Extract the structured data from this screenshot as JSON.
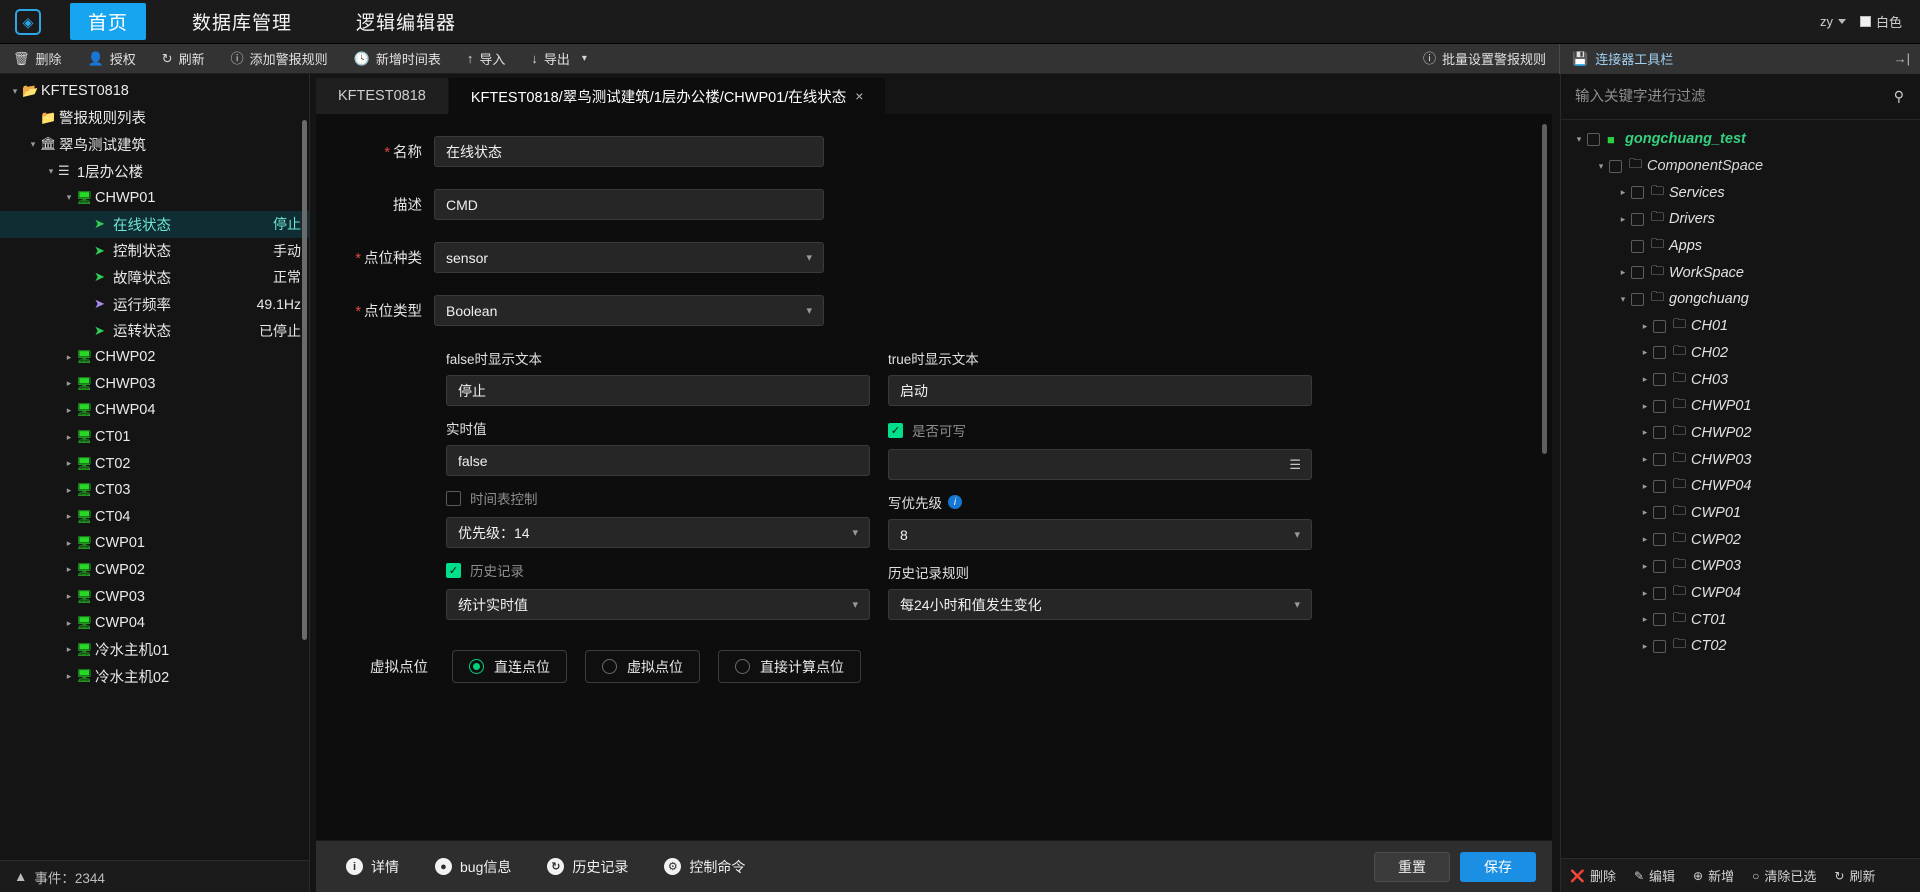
{
  "topbar": {
    "logo_icon": "cube-icon",
    "nav": [
      {
        "label": "首页",
        "active": true
      },
      {
        "label": "数据库管理",
        "active": false
      },
      {
        "label": "逻辑编辑器",
        "active": false
      }
    ],
    "user": "zy",
    "theme_label": "白色"
  },
  "toolbar": {
    "items": [
      {
        "label": "删除",
        "icon": "trash-icon"
      },
      {
        "label": "授权",
        "icon": "user-icon"
      },
      {
        "label": "刷新",
        "icon": "refresh-icon"
      },
      {
        "label": "添加警报规则",
        "icon": "alert-icon"
      },
      {
        "label": "新增时间表",
        "icon": "clock-icon"
      },
      {
        "label": "导入",
        "icon": "import-arrow-up-icon"
      },
      {
        "label": "导出",
        "icon": "export-arrow-down-icon"
      }
    ],
    "export_caret": "chevron-down-icon",
    "batch_alarm": {
      "label": "批量设置警报规则",
      "icon": "alert-icon"
    },
    "connector_panel": {
      "label": "连接器工具栏",
      "icon": "save-disk-icon",
      "expand_icon": "expand-right-icon"
    }
  },
  "tree": {
    "scrollbar": "vertical-scrollbar",
    "nodes": [
      {
        "label": "KFTEST0818",
        "value": "",
        "depth": 0,
        "twisty": "down",
        "icon": "folder-open-icon",
        "icon_class": "ico-folder",
        "selected": false
      },
      {
        "label": "警报规则列表",
        "value": "",
        "depth": 1,
        "twisty": "none",
        "icon": "folder-icon",
        "icon_class": "ico-folder",
        "selected": false
      },
      {
        "label": "翠鸟测试建筑",
        "value": "",
        "depth": 1,
        "twisty": "down",
        "icon": "building-icon",
        "icon_class": "ico-building",
        "selected": false
      },
      {
        "label": "1层办公楼",
        "value": "",
        "depth": 2,
        "twisty": "down",
        "icon": "layers-icon",
        "icon_class": "ico-layer",
        "selected": false
      },
      {
        "label": "CHWP01",
        "value": "",
        "depth": 3,
        "twisty": "down",
        "icon": "device-icon",
        "icon_class": "ico-dev",
        "selected": false
      },
      {
        "label": "在线状态",
        "value": "停止",
        "depth": 4,
        "twisty": "none",
        "icon": "point-icon",
        "icon_class": "ico-pt-green",
        "selected": true
      },
      {
        "label": "控制状态",
        "value": "手动",
        "depth": 4,
        "twisty": "none",
        "icon": "point-icon",
        "icon_class": "ico-pt-green",
        "selected": false
      },
      {
        "label": "故障状态",
        "value": "正常",
        "depth": 4,
        "twisty": "none",
        "icon": "point-icon",
        "icon_class": "ico-pt-green",
        "selected": false
      },
      {
        "label": "运行频率",
        "value": "49.1Hz",
        "depth": 4,
        "twisty": "none",
        "icon": "point-icon",
        "icon_class": "ico-pt-purple",
        "selected": false
      },
      {
        "label": "运转状态",
        "value": "已停止",
        "depth": 4,
        "twisty": "none",
        "icon": "point-icon",
        "icon_class": "ico-pt-green",
        "selected": false
      },
      {
        "label": "CHWP02",
        "value": "",
        "depth": 3,
        "twisty": "right",
        "icon": "device-icon",
        "icon_class": "ico-dev",
        "selected": false
      },
      {
        "label": "CHWP03",
        "value": "",
        "depth": 3,
        "twisty": "right",
        "icon": "device-icon",
        "icon_class": "ico-dev",
        "selected": false
      },
      {
        "label": "CHWP04",
        "value": "",
        "depth": 3,
        "twisty": "right",
        "icon": "device-icon",
        "icon_class": "ico-dev",
        "selected": false
      },
      {
        "label": "CT01",
        "value": "",
        "depth": 3,
        "twisty": "right",
        "icon": "device-icon",
        "icon_class": "ico-dev",
        "selected": false
      },
      {
        "label": "CT02",
        "value": "",
        "depth": 3,
        "twisty": "right",
        "icon": "device-icon",
        "icon_class": "ico-dev",
        "selected": false
      },
      {
        "label": "CT03",
        "value": "",
        "depth": 3,
        "twisty": "right",
        "icon": "device-icon",
        "icon_class": "ico-dev",
        "selected": false
      },
      {
        "label": "CT04",
        "value": "",
        "depth": 3,
        "twisty": "right",
        "icon": "device-icon",
        "icon_class": "ico-dev",
        "selected": false
      },
      {
        "label": "CWP01",
        "value": "",
        "depth": 3,
        "twisty": "right",
        "icon": "device-icon",
        "icon_class": "ico-dev",
        "selected": false
      },
      {
        "label": "CWP02",
        "value": "",
        "depth": 3,
        "twisty": "right",
        "icon": "device-icon",
        "icon_class": "ico-dev",
        "selected": false
      },
      {
        "label": "CWP03",
        "value": "",
        "depth": 3,
        "twisty": "right",
        "icon": "device-icon",
        "icon_class": "ico-dev",
        "selected": false
      },
      {
        "label": "CWP04",
        "value": "",
        "depth": 3,
        "twisty": "right",
        "icon": "device-icon",
        "icon_class": "ico-dev",
        "selected": false
      },
      {
        "label": "冷水主机01",
        "value": "",
        "depth": 3,
        "twisty": "right",
        "icon": "device-icon",
        "icon_class": "ico-dev",
        "selected": false
      },
      {
        "label": "冷水主机02",
        "value": "",
        "depth": 3,
        "twisty": "right",
        "icon": "device-icon",
        "icon_class": "ico-dev",
        "selected": false
      }
    ]
  },
  "statusbar": {
    "icon": "chevron-up-icon",
    "label": "事件：2344"
  },
  "tabs": [
    {
      "label": "KFTEST0818",
      "active": false,
      "closable": false
    },
    {
      "label": "KFTEST0818/翠鸟测试建筑/1层办公楼/CHWP01/在线状态",
      "active": true,
      "closable": true,
      "close_icon": "close-icon"
    }
  ],
  "form": {
    "name": {
      "label": "名称",
      "required": true,
      "value": "在线状态"
    },
    "description": {
      "label": "描述",
      "required": false,
      "value": "CMD"
    },
    "point_kind": {
      "label": "点位种类",
      "required": true,
      "value": "sensor",
      "chevron": "chevron-down-icon"
    },
    "point_type": {
      "label": "点位类型",
      "required": true,
      "value": "Boolean",
      "chevron": "chevron-down-icon"
    },
    "false_text": {
      "label": "false时显示文本",
      "value": "停止"
    },
    "true_text": {
      "label": "true时显示文本",
      "value": "启动"
    },
    "realtime_value": {
      "label": "实时值",
      "value": "false"
    },
    "writable": {
      "label": "是否可写",
      "checked": true
    },
    "write_value": {
      "value": "",
      "menu_icon": "list-menu-icon"
    },
    "schedule_control": {
      "label": "时间表控制",
      "checked": false,
      "disabled": true
    },
    "priority": {
      "value": "优先级：14",
      "chevron": "chevron-down-icon"
    },
    "write_priority": {
      "label": "写优先级",
      "info_icon": "info-icon",
      "value": "8",
      "chevron": "chevron-down-icon"
    },
    "history_record": {
      "label": "历史记录",
      "checked": true
    },
    "history_mode": {
      "value": "统计实时值",
      "chevron": "chevron-down-icon"
    },
    "history_rule": {
      "label": "历史记录规则",
      "value": "每24小时和值发生变化",
      "chevron": "chevron-down-icon"
    },
    "virtual_point": {
      "label": "虚拟点位",
      "options": [
        {
          "label": "直连点位",
          "selected": true
        },
        {
          "label": "虚拟点位",
          "selected": false
        },
        {
          "label": "直接计算点位",
          "selected": false
        }
      ]
    }
  },
  "panel_footer": {
    "actions": [
      {
        "label": "详情",
        "icon": "info-circle-icon"
      },
      {
        "label": "bug信息",
        "icon": "bug-icon"
      },
      {
        "label": "历史记录",
        "icon": "history-clock-icon"
      },
      {
        "label": "控制命令",
        "icon": "gear-icon"
      }
    ],
    "reset_label": "重置",
    "save_label": "保存"
  },
  "connector": {
    "search_placeholder": "输入关键字进行过滤",
    "search_value": "",
    "search_icon": "search-icon",
    "nodes": [
      {
        "label": "gongchuang_test",
        "depth": 0,
        "twisty": "down",
        "checkbox": true,
        "icon": "green-square-icon",
        "icon_class": "ico-green-sq",
        "label_class": "lbl-root"
      },
      {
        "label": "ComponentSpace",
        "depth": 1,
        "twisty": "down",
        "checkbox": true,
        "icon": "folder-outline-icon",
        "icon_class": "ico-fold",
        "label_class": "lbl-cs"
      },
      {
        "label": "Services",
        "depth": 2,
        "twisty": "right",
        "checkbox": true,
        "icon": "folder-outline-icon",
        "icon_class": "ico-fold",
        "label_class": "lbl-it"
      },
      {
        "label": "Drivers",
        "depth": 2,
        "twisty": "right",
        "checkbox": true,
        "icon": "folder-outline-icon",
        "icon_class": "ico-fold",
        "label_class": "lbl-it"
      },
      {
        "label": "Apps",
        "depth": 2,
        "twisty": "none",
        "checkbox": true,
        "icon": "folder-outline-icon",
        "icon_class": "ico-fold",
        "label_class": "lbl-it"
      },
      {
        "label": "WorkSpace",
        "depth": 2,
        "twisty": "right",
        "checkbox": true,
        "icon": "folder-outline-icon",
        "icon_class": "ico-fold",
        "label_class": "lbl-it"
      },
      {
        "label": "gongchuang",
        "depth": 2,
        "twisty": "down",
        "checkbox": true,
        "icon": "folder-outline-icon",
        "icon_class": "ico-fold",
        "label_class": "lbl-it"
      },
      {
        "label": "CH01",
        "depth": 3,
        "twisty": "right",
        "checkbox": true,
        "icon": "folder-outline-icon",
        "icon_class": "ico-fold",
        "label_class": "lbl-it"
      },
      {
        "label": "CH02",
        "depth": 3,
        "twisty": "right",
        "checkbox": true,
        "icon": "folder-outline-icon",
        "icon_class": "ico-fold",
        "label_class": "lbl-it"
      },
      {
        "label": "CH03",
        "depth": 3,
        "twisty": "right",
        "checkbox": true,
        "icon": "folder-outline-icon",
        "icon_class": "ico-fold",
        "label_class": "lbl-it"
      },
      {
        "label": "CHWP01",
        "depth": 3,
        "twisty": "right",
        "checkbox": true,
        "icon": "folder-outline-icon",
        "icon_class": "ico-fold",
        "label_class": "lbl-it"
      },
      {
        "label": "CHWP02",
        "depth": 3,
        "twisty": "right",
        "checkbox": true,
        "icon": "folder-outline-icon",
        "icon_class": "ico-fold",
        "label_class": "lbl-it"
      },
      {
        "label": "CHWP03",
        "depth": 3,
        "twisty": "right",
        "checkbox": true,
        "icon": "folder-outline-icon",
        "icon_class": "ico-fold",
        "label_class": "lbl-it"
      },
      {
        "label": "CHWP04",
        "depth": 3,
        "twisty": "right",
        "checkbox": true,
        "icon": "folder-outline-icon",
        "icon_class": "ico-fold",
        "label_class": "lbl-it"
      },
      {
        "label": "CWP01",
        "depth": 3,
        "twisty": "right",
        "checkbox": true,
        "icon": "folder-outline-icon",
        "icon_class": "ico-fold",
        "label_class": "lbl-it"
      },
      {
        "label": "CWP02",
        "depth": 3,
        "twisty": "right",
        "checkbox": true,
        "icon": "folder-outline-icon",
        "icon_class": "ico-fold",
        "label_class": "lbl-it"
      },
      {
        "label": "CWP03",
        "depth": 3,
        "twisty": "right",
        "checkbox": true,
        "icon": "folder-outline-icon",
        "icon_class": "ico-fold",
        "label_class": "lbl-it"
      },
      {
        "label": "CWP04",
        "depth": 3,
        "twisty": "right",
        "checkbox": true,
        "icon": "folder-outline-icon",
        "icon_class": "ico-fold",
        "label_class": "lbl-it"
      },
      {
        "label": "CT01",
        "depth": 3,
        "twisty": "right",
        "checkbox": true,
        "icon": "folder-outline-icon",
        "icon_class": "ico-fold",
        "label_class": "lbl-it"
      },
      {
        "label": "CT02",
        "depth": 3,
        "twisty": "right",
        "checkbox": true,
        "icon": "folder-outline-icon",
        "icon_class": "ico-fold",
        "label_class": "lbl-it"
      }
    ],
    "footer": [
      {
        "label": "删除",
        "icon": "delete-circle-icon"
      },
      {
        "label": "编辑",
        "icon": "edit-icon"
      },
      {
        "label": "新增",
        "icon": "plus-circle-icon"
      },
      {
        "label": "清除已选",
        "icon": "clear-circle-icon"
      },
      {
        "label": "刷新",
        "icon": "refresh-icon"
      }
    ]
  },
  "colors": {
    "accent_blue": "#18a5f0",
    "accent_green": "#00e08a",
    "selected_row": "#0f2d33",
    "required_red": "#e04a3f"
  }
}
